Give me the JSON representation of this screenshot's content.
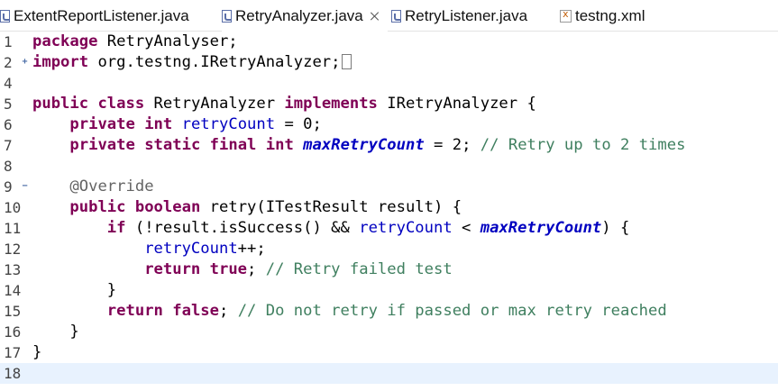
{
  "tabs": [
    {
      "label": "ExtentReportListener.java",
      "icon": "java-file-icon",
      "active": false
    },
    {
      "label": "RetryAnalyzer.java",
      "icon": "java-file-icon",
      "active": true,
      "close_icon": "close-icon"
    },
    {
      "label": "RetryListener.java",
      "icon": "java-file-icon",
      "active": false
    },
    {
      "label": "testng.xml",
      "icon": "xml-file-icon",
      "active": false
    }
  ],
  "editor": {
    "current_line": 18,
    "lines": [
      {
        "num": "1",
        "tokens": [
          [
            "kw",
            "package"
          ],
          [
            "plain",
            " RetryAnalyser;"
          ]
        ]
      },
      {
        "num": "2",
        "fold": "plus",
        "tokens": [
          [
            "kw",
            "import"
          ],
          [
            "plain",
            " org.testng.IRetryAnalyzer;"
          ]
        ],
        "collapsed_marker": true
      },
      {
        "num": "4",
        "tokens": []
      },
      {
        "num": "5",
        "tokens": [
          [
            "kw",
            "public"
          ],
          [
            "plain",
            " "
          ],
          [
            "kw",
            "class"
          ],
          [
            "plain",
            " RetryAnalyzer "
          ],
          [
            "kw",
            "implements"
          ],
          [
            "plain",
            " IRetryAnalyzer {"
          ]
        ]
      },
      {
        "num": "6",
        "tokens": [
          [
            "plain",
            "    "
          ],
          [
            "kw",
            "private"
          ],
          [
            "plain",
            " "
          ],
          [
            "kw",
            "int"
          ],
          [
            "plain",
            " "
          ],
          [
            "fld",
            "retryCount"
          ],
          [
            "plain",
            " = 0;"
          ]
        ]
      },
      {
        "num": "7",
        "tokens": [
          [
            "plain",
            "    "
          ],
          [
            "kw",
            "private"
          ],
          [
            "plain",
            " "
          ],
          [
            "kw",
            "static"
          ],
          [
            "plain",
            " "
          ],
          [
            "kw",
            "final"
          ],
          [
            "plain",
            " "
          ],
          [
            "kw",
            "int"
          ],
          [
            "plain",
            " "
          ],
          [
            "sfld",
            "maxRetryCount"
          ],
          [
            "plain",
            " = 2; "
          ],
          [
            "cmt",
            "// Retry up to 2 times"
          ]
        ]
      },
      {
        "num": "8",
        "tokens": []
      },
      {
        "num": "9",
        "fold": "minus",
        "tokens": [
          [
            "plain",
            "    "
          ],
          [
            "ann",
            "@Override"
          ]
        ]
      },
      {
        "num": "10",
        "tokens": [
          [
            "plain",
            "    "
          ],
          [
            "kw",
            "public"
          ],
          [
            "plain",
            " "
          ],
          [
            "kw",
            "boolean"
          ],
          [
            "plain",
            " retry(ITestResult "
          ],
          [
            "plain",
            "result"
          ],
          [
            "plain",
            ") {"
          ]
        ]
      },
      {
        "num": "11",
        "tokens": [
          [
            "plain",
            "        "
          ],
          [
            "kw",
            "if"
          ],
          [
            "plain",
            " (!"
          ],
          [
            "plain",
            "result"
          ],
          [
            "plain",
            ".isSuccess() && "
          ],
          [
            "fld",
            "retryCount"
          ],
          [
            "plain",
            " < "
          ],
          [
            "sfld",
            "maxRetryCount"
          ],
          [
            "plain",
            ") {"
          ]
        ]
      },
      {
        "num": "12",
        "tokens": [
          [
            "plain",
            "            "
          ],
          [
            "fld",
            "retryCount"
          ],
          [
            "plain",
            "++;"
          ]
        ]
      },
      {
        "num": "13",
        "tokens": [
          [
            "plain",
            "            "
          ],
          [
            "kw",
            "return"
          ],
          [
            "plain",
            " "
          ],
          [
            "kw",
            "true"
          ],
          [
            "plain",
            "; "
          ],
          [
            "cmt",
            "// Retry failed test"
          ]
        ]
      },
      {
        "num": "14",
        "tokens": [
          [
            "plain",
            "        }"
          ]
        ]
      },
      {
        "num": "15",
        "tokens": [
          [
            "plain",
            "        "
          ],
          [
            "kw",
            "return"
          ],
          [
            "plain",
            " "
          ],
          [
            "kw",
            "false"
          ],
          [
            "plain",
            "; "
          ],
          [
            "cmt",
            "// Do not retry if passed or max retry reached"
          ]
        ]
      },
      {
        "num": "16",
        "tokens": [
          [
            "plain",
            "    }"
          ]
        ]
      },
      {
        "num": "17",
        "tokens": [
          [
            "plain",
            "}"
          ]
        ]
      },
      {
        "num": "18",
        "tokens": []
      }
    ]
  }
}
